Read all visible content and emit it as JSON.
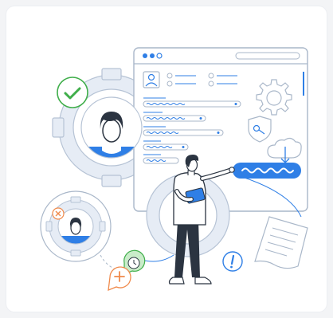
{
  "colors": {
    "accent": "#2f7fe6",
    "accent_light": "#dbe8fb",
    "outline": "#a9b7c9",
    "gear": "#e6ecf5",
    "green": "#3fae4a",
    "orange": "#f08a4b",
    "dark": "#2b3441"
  },
  "icons": [
    "gear-icon",
    "checkmark-icon",
    "user-avatar-icon",
    "shield-key-icon",
    "cloud-download-icon",
    "clock-icon",
    "plus-icon",
    "close-icon",
    "exclamation-icon",
    "document-icon"
  ]
}
